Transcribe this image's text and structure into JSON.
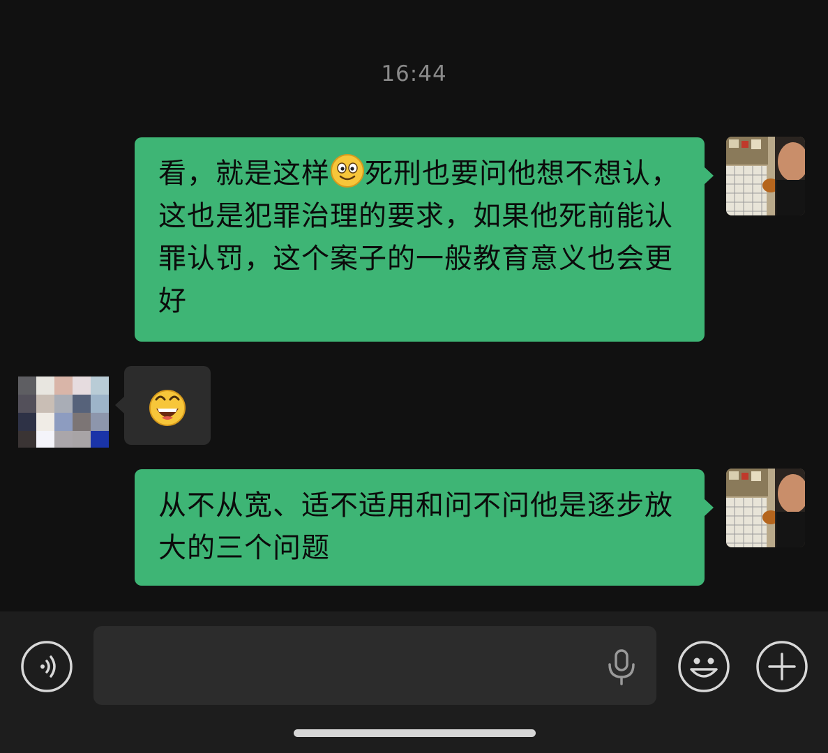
{
  "chat": {
    "timestamp": "16:44",
    "messages": [
      {
        "sender": "self",
        "text_before_emoji": "看，就是这样",
        "emoji": "smile-emoji",
        "text_after_emoji": "死刑也要问他想不想认，这也是犯罪治理的要求，如果他死前能认罪认罚，这个案子的一般教育意义也会更好"
      },
      {
        "sender": "other",
        "emoji": "grin-emoji"
      },
      {
        "sender": "self",
        "text": "从不从宽、适不适用和问不问他是逐步放大的三个问题"
      }
    ]
  },
  "input_bar": {
    "voice_icon": "voice-icon",
    "message_value": "",
    "mic_icon": "microphone-icon",
    "emoji_icon": "emoji-icon",
    "more_icon": "plus-icon"
  },
  "colors": {
    "background": "#111111",
    "outgoing_bubble": "#3eb575",
    "incoming_bubble": "#2c2c2c",
    "input_bar": "#1d1d1d",
    "timestamp": "#8a8a8a"
  }
}
